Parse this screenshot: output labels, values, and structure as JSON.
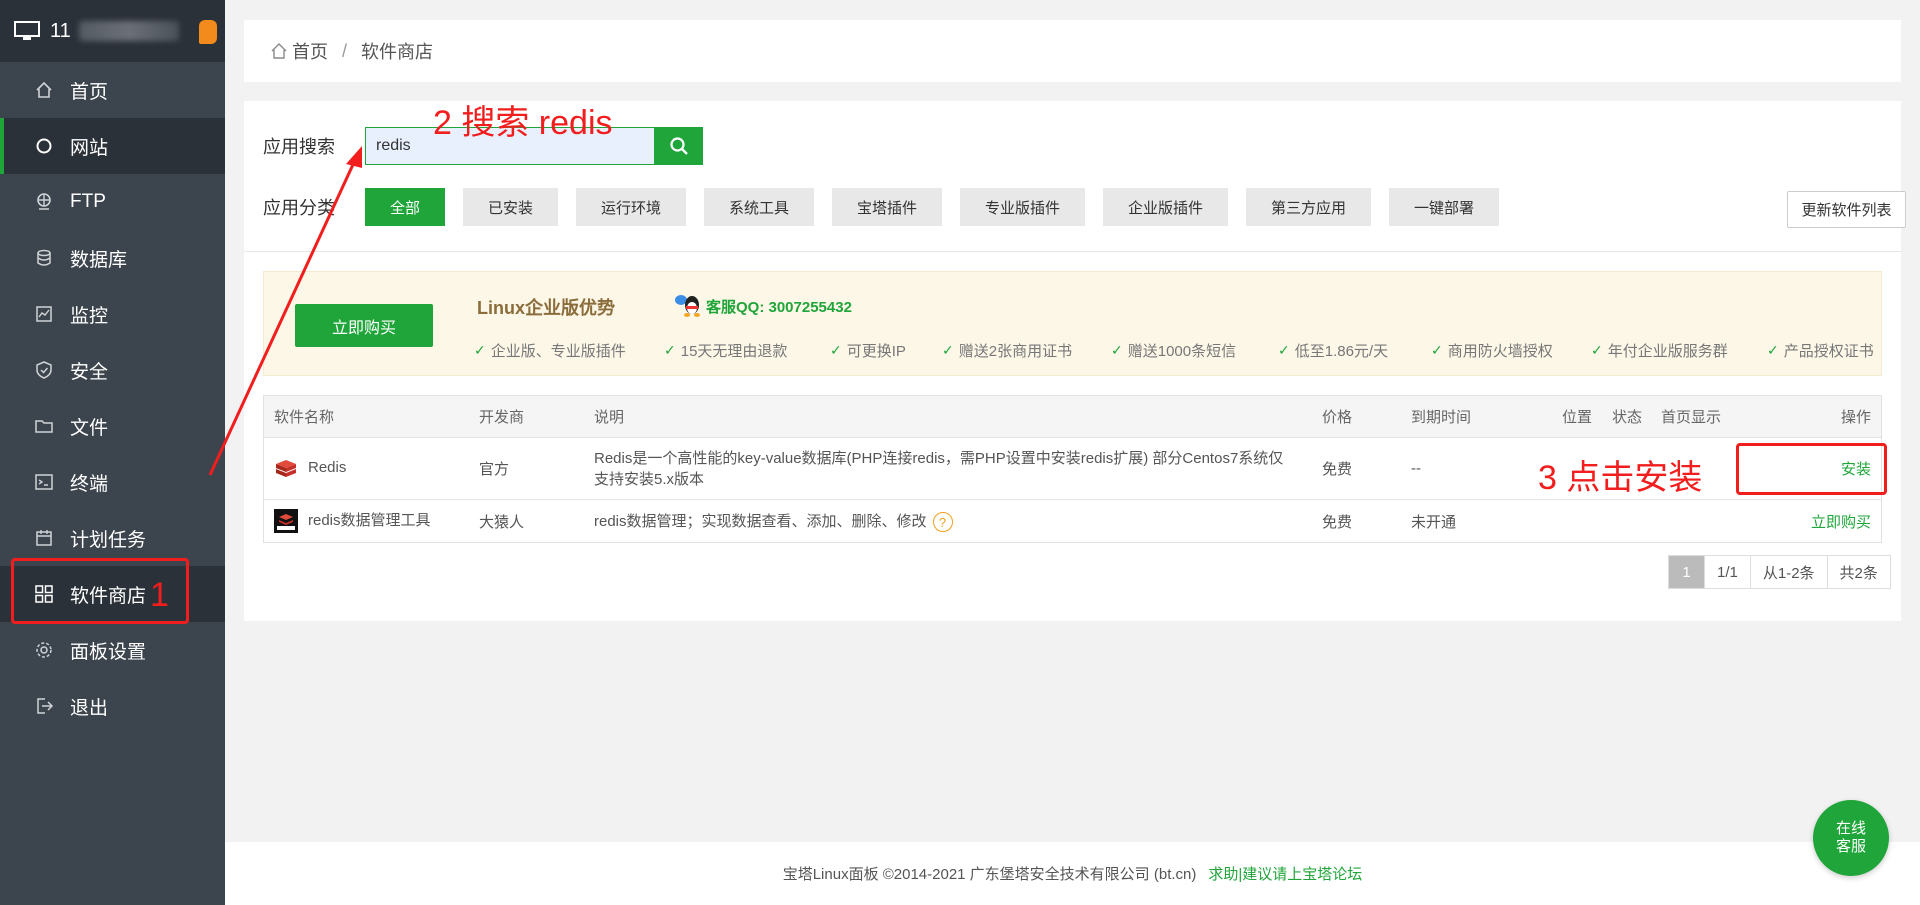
{
  "sidebar": {
    "ip_prefix": "11",
    "items": [
      {
        "label": "首页",
        "icon": "home-icon"
      },
      {
        "label": "网站",
        "icon": "circle-icon"
      },
      {
        "label": "FTP",
        "icon": "ftp-icon"
      },
      {
        "label": "数据库",
        "icon": "database-icon"
      },
      {
        "label": "监控",
        "icon": "monitor-chart-icon"
      },
      {
        "label": "安全",
        "icon": "shield-icon"
      },
      {
        "label": "文件",
        "icon": "folder-icon"
      },
      {
        "label": "终端",
        "icon": "terminal-icon"
      },
      {
        "label": "计划任务",
        "icon": "calendar-icon"
      },
      {
        "label": "软件商店",
        "icon": "grid-icon"
      },
      {
        "label": "面板设置",
        "icon": "gear-icon"
      },
      {
        "label": "退出",
        "icon": "logout-icon"
      }
    ]
  },
  "breadcrumb": {
    "home": "首页",
    "sep": "/",
    "current": "软件商店"
  },
  "search": {
    "label": "应用搜索",
    "value": "redis"
  },
  "categories": {
    "label": "应用分类",
    "items": [
      "全部",
      "已安装",
      "运行环境",
      "系统工具",
      "宝塔插件",
      "专业版插件",
      "企业版插件",
      "第三方应用",
      "一键部署"
    ],
    "refresh": "更新软件列表"
  },
  "promo": {
    "buy": "立即购买",
    "title": "Linux企业版优势",
    "qq": "客服QQ: 3007255432",
    "features": [
      "企业版、专业版插件",
      "15天无理由退款",
      "可更换IP",
      "赠送2张商用证书",
      "赠送1000条短信",
      "低至1.86元/天",
      "商用防火墙授权",
      "年付企业版服务群",
      "产品授权证书"
    ]
  },
  "table": {
    "headers": [
      "软件名称",
      "开发商",
      "说明",
      "价格",
      "到期时间",
      "位置",
      "状态",
      "首页显示",
      "操作"
    ],
    "rows": [
      {
        "name": "Redis",
        "vendor": "官方",
        "desc1": "Redis是一个高性能的key-value数据库(PHP连接redis，需PHP设置中安装redis扩展) 部分Centos7系统仅",
        "desc2": "支持安装5.x版本",
        "price": "免费",
        "expire": "--",
        "action": "安装"
      },
      {
        "name": "redis数据管理工具",
        "vendor": "大猿人",
        "desc1": "redis数据管理；实现数据查看、添加、删除、修改",
        "price": "免费",
        "expire": "未开通",
        "action": "立即购买"
      }
    ]
  },
  "pager": {
    "current": "1",
    "pages": "1/1",
    "range": "从1-2条",
    "total": "共2条"
  },
  "footer": {
    "copyright": "宝塔Linux面板 ©2014-2021 广东堡塔安全技术有限公司 (bt.cn)",
    "link": "求助|建议请上宝塔论坛"
  },
  "chat": {
    "line1": "在线",
    "line2": "客服"
  },
  "annotations": {
    "step1": "1",
    "step2": "2 搜索 redis",
    "step3": "3 点击安装"
  },
  "colors": {
    "accent": "#20a53a",
    "annotation": "#f21d1d",
    "sidebar": "#3c444d"
  }
}
